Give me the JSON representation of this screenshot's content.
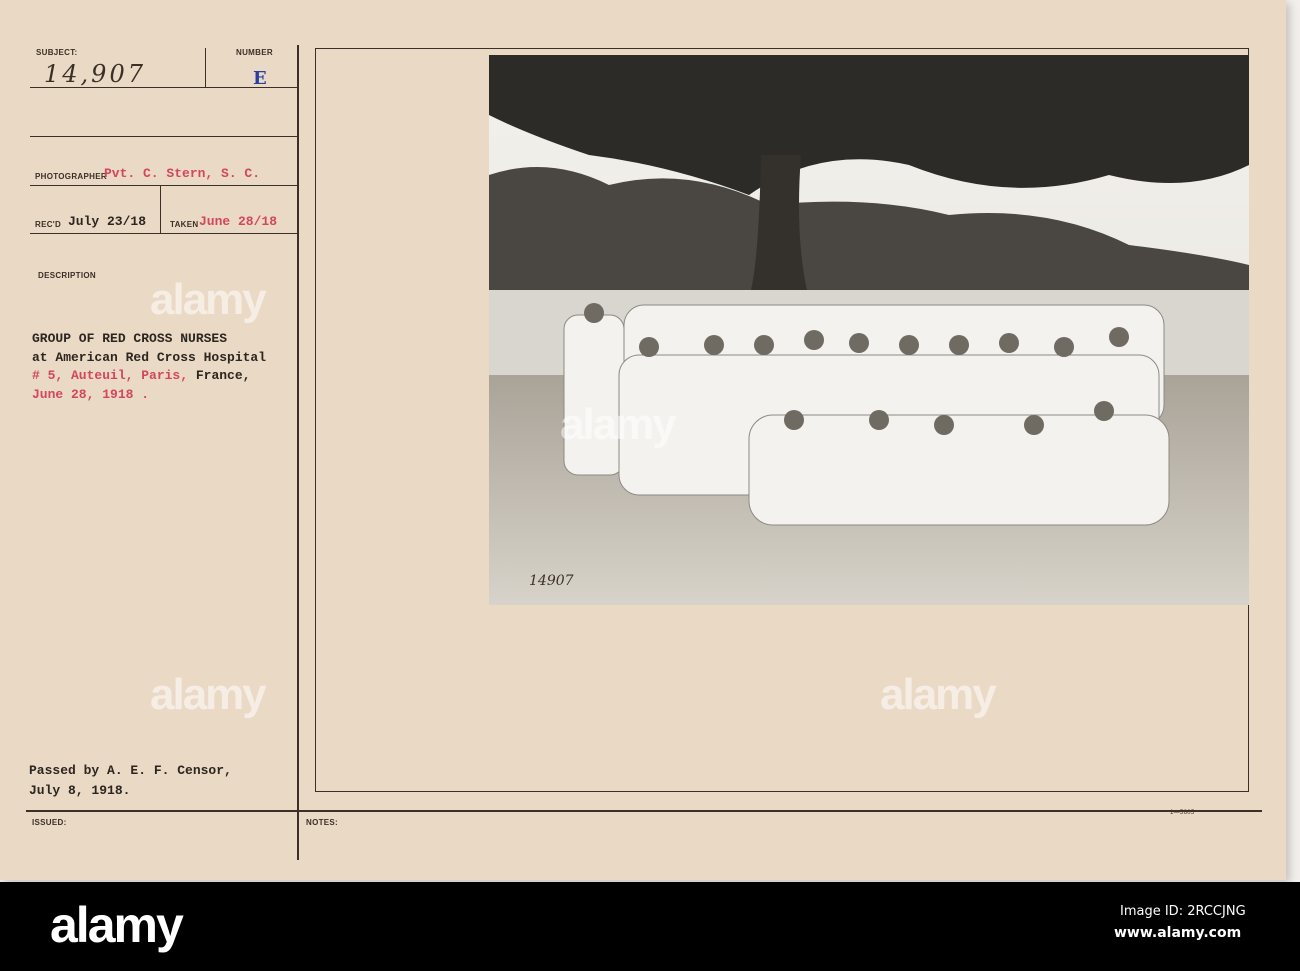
{
  "card": {
    "subject_label": "SUBJECT:",
    "subject_value": "14,907",
    "number_label": "NUMBER",
    "number_value": "E",
    "photographer_label": "PHOTOGRAPHER",
    "photographer_value": "Pvt. C. Stern, S. C.",
    "recd_label": "REC'D",
    "recd_value": "July 23/18",
    "taken_label": "TAKEN",
    "taken_value": "June 28/18",
    "description_label": "DESCRIPTION",
    "description_lines": [
      "GROUP OF RED CROSS NURSES",
      "at American Red Cross Hospital",
      "# 5, Auteuil, Paris,",
      "France,",
      "June 28, 1918 ."
    ],
    "censor_lines": [
      "Passed by A. E. F. Censor,",
      "July 8, 1918."
    ],
    "issued_label": "ISSUED:",
    "notes_label": "NOTES:",
    "form_number": "1—5605",
    "photo_inscription": "14907"
  },
  "watermark": {
    "text": "alamy",
    "image_id": "Image ID: 2RCCJNG",
    "url": "www.alamy.com"
  },
  "colors": {
    "card": "#ead9c5",
    "red_ink": "#d2485a",
    "blue_stamp": "#2a3fa0"
  }
}
